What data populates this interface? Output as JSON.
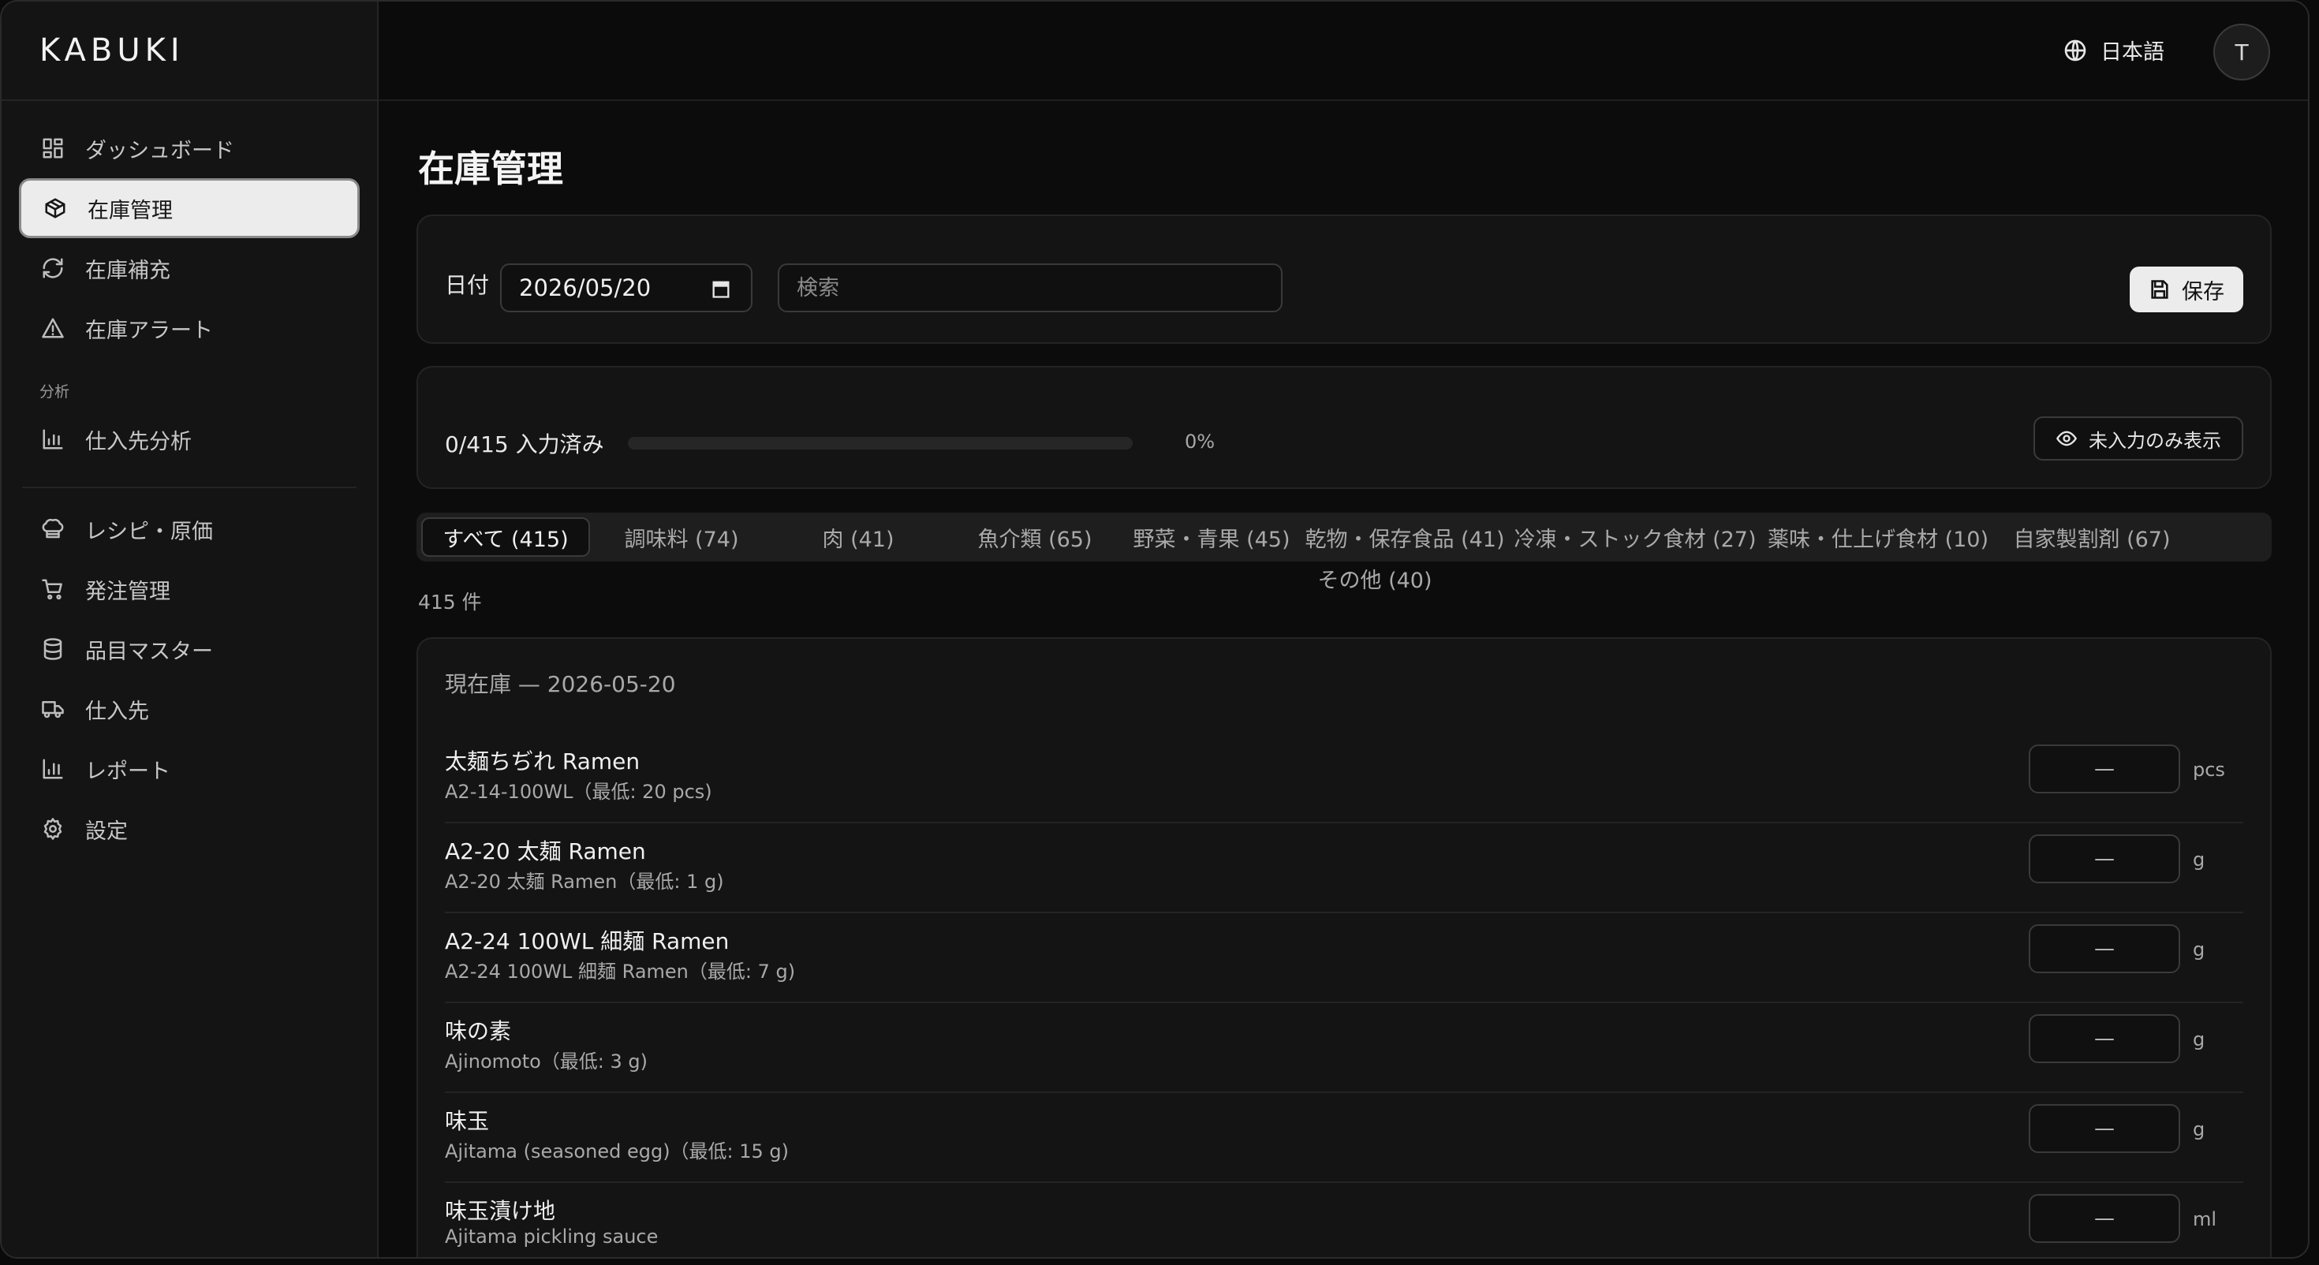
{
  "brand": "KABUKI",
  "sidebar": {
    "items": [
      {
        "label": "ダッシュボード",
        "icon": "dashboard-icon"
      },
      {
        "label": "在庫管理",
        "icon": "box-icon",
        "active": true
      },
      {
        "label": "在庫補充",
        "icon": "refresh-icon"
      },
      {
        "label": "在庫アラート",
        "icon": "warning-icon"
      }
    ],
    "section_label": "分析",
    "analysis_items": [
      {
        "label": "仕入先分析",
        "icon": "bar-chart-icon"
      }
    ],
    "lower_items": [
      {
        "label": "レシピ・原価",
        "icon": "chef-hat-icon"
      },
      {
        "label": "発注管理",
        "icon": "cart-icon"
      },
      {
        "label": "品目マスター",
        "icon": "database-icon"
      },
      {
        "label": "仕入先",
        "icon": "truck-icon"
      },
      {
        "label": "レポート",
        "icon": "report-chart-icon"
      },
      {
        "label": "設定",
        "icon": "gear-icon"
      }
    ]
  },
  "header": {
    "language": "日本語",
    "avatar_initial": "T"
  },
  "main": {
    "title": "在庫管理",
    "date_label": "日付",
    "date_value": "2026/05/20",
    "search_placeholder": "検索",
    "save_label": "保存",
    "progress_text": "0/415 入力済み",
    "progress_percent_text": "0%",
    "progress_fraction": 0,
    "unfilled_toggle_label": "未入力のみ表示",
    "tabs": [
      {
        "label": "すべて (415)",
        "active": true
      },
      {
        "label": "調味料 (74)"
      },
      {
        "label": "肉 (41)"
      },
      {
        "label": "魚介類 (65)"
      },
      {
        "label": "野菜・青果 (45)"
      },
      {
        "label": "乾物・保存食品 (41)"
      },
      {
        "label": "冷凍・ストック食材 (27)"
      },
      {
        "label": "薬味・仕上げ食材 (10)"
      },
      {
        "label": "自家製割剤 (67)"
      },
      {
        "label": "その他 (40)"
      }
    ],
    "result_count": "415 件",
    "list_title": "現在庫 — 2026-05-20",
    "items": [
      {
        "name": "太麺ちぢれ Ramen",
        "sub": "A2-14-100WL（最低: 20 pcs)",
        "qty": "—",
        "unit": "pcs"
      },
      {
        "name": "A2-20 太麺 Ramen",
        "sub": "A2-20 太麺 Ramen（最低: 1 g)",
        "qty": "—",
        "unit": "g"
      },
      {
        "name": "A2-24 100WL 細麺 Ramen",
        "sub": "A2-24 100WL 細麺 Ramen（最低: 7 g)",
        "qty": "—",
        "unit": "g"
      },
      {
        "name": "味の素",
        "sub": "Ajinomoto（最低: 3 g)",
        "qty": "—",
        "unit": "g"
      },
      {
        "name": "味玉",
        "sub": "Ajitama (seasoned egg)（最低: 15 g)",
        "qty": "—",
        "unit": "g"
      },
      {
        "name": "味玉漬け地",
        "sub": "Ajitama pickling sauce",
        "qty": "—",
        "unit": "ml"
      }
    ]
  }
}
